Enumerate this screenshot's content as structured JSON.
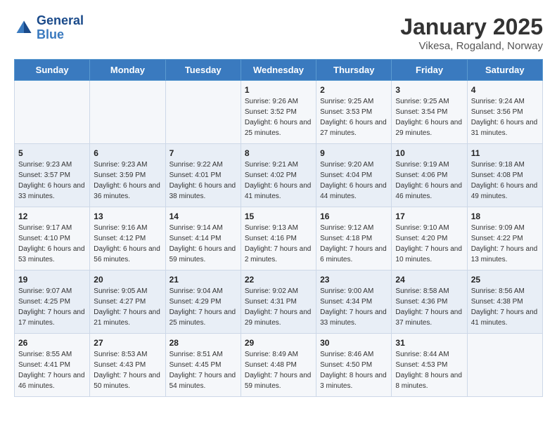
{
  "logo": {
    "line1": "General",
    "line2": "Blue"
  },
  "title": "January 2025",
  "subtitle": "Vikesa, Rogaland, Norway",
  "days_header": [
    "Sunday",
    "Monday",
    "Tuesday",
    "Wednesday",
    "Thursday",
    "Friday",
    "Saturday"
  ],
  "weeks": [
    [
      {
        "day": "",
        "content": ""
      },
      {
        "day": "",
        "content": ""
      },
      {
        "day": "",
        "content": ""
      },
      {
        "day": "1",
        "content": "Sunrise: 9:26 AM\nSunset: 3:52 PM\nDaylight: 6 hours and 25 minutes."
      },
      {
        "day": "2",
        "content": "Sunrise: 9:25 AM\nSunset: 3:53 PM\nDaylight: 6 hours and 27 minutes."
      },
      {
        "day": "3",
        "content": "Sunrise: 9:25 AM\nSunset: 3:54 PM\nDaylight: 6 hours and 29 minutes."
      },
      {
        "day": "4",
        "content": "Sunrise: 9:24 AM\nSunset: 3:56 PM\nDaylight: 6 hours and 31 minutes."
      }
    ],
    [
      {
        "day": "5",
        "content": "Sunrise: 9:23 AM\nSunset: 3:57 PM\nDaylight: 6 hours and 33 minutes."
      },
      {
        "day": "6",
        "content": "Sunrise: 9:23 AM\nSunset: 3:59 PM\nDaylight: 6 hours and 36 minutes."
      },
      {
        "day": "7",
        "content": "Sunrise: 9:22 AM\nSunset: 4:01 PM\nDaylight: 6 hours and 38 minutes."
      },
      {
        "day": "8",
        "content": "Sunrise: 9:21 AM\nSunset: 4:02 PM\nDaylight: 6 hours and 41 minutes."
      },
      {
        "day": "9",
        "content": "Sunrise: 9:20 AM\nSunset: 4:04 PM\nDaylight: 6 hours and 44 minutes."
      },
      {
        "day": "10",
        "content": "Sunrise: 9:19 AM\nSunset: 4:06 PM\nDaylight: 6 hours and 46 minutes."
      },
      {
        "day": "11",
        "content": "Sunrise: 9:18 AM\nSunset: 4:08 PM\nDaylight: 6 hours and 49 minutes."
      }
    ],
    [
      {
        "day": "12",
        "content": "Sunrise: 9:17 AM\nSunset: 4:10 PM\nDaylight: 6 hours and 53 minutes."
      },
      {
        "day": "13",
        "content": "Sunrise: 9:16 AM\nSunset: 4:12 PM\nDaylight: 6 hours and 56 minutes."
      },
      {
        "day": "14",
        "content": "Sunrise: 9:14 AM\nSunset: 4:14 PM\nDaylight: 6 hours and 59 minutes."
      },
      {
        "day": "15",
        "content": "Sunrise: 9:13 AM\nSunset: 4:16 PM\nDaylight: 7 hours and 2 minutes."
      },
      {
        "day": "16",
        "content": "Sunrise: 9:12 AM\nSunset: 4:18 PM\nDaylight: 7 hours and 6 minutes."
      },
      {
        "day": "17",
        "content": "Sunrise: 9:10 AM\nSunset: 4:20 PM\nDaylight: 7 hours and 10 minutes."
      },
      {
        "day": "18",
        "content": "Sunrise: 9:09 AM\nSunset: 4:22 PM\nDaylight: 7 hours and 13 minutes."
      }
    ],
    [
      {
        "day": "19",
        "content": "Sunrise: 9:07 AM\nSunset: 4:25 PM\nDaylight: 7 hours and 17 minutes."
      },
      {
        "day": "20",
        "content": "Sunrise: 9:05 AM\nSunset: 4:27 PM\nDaylight: 7 hours and 21 minutes."
      },
      {
        "day": "21",
        "content": "Sunrise: 9:04 AM\nSunset: 4:29 PM\nDaylight: 7 hours and 25 minutes."
      },
      {
        "day": "22",
        "content": "Sunrise: 9:02 AM\nSunset: 4:31 PM\nDaylight: 7 hours and 29 minutes."
      },
      {
        "day": "23",
        "content": "Sunrise: 9:00 AM\nSunset: 4:34 PM\nDaylight: 7 hours and 33 minutes."
      },
      {
        "day": "24",
        "content": "Sunrise: 8:58 AM\nSunset: 4:36 PM\nDaylight: 7 hours and 37 minutes."
      },
      {
        "day": "25",
        "content": "Sunrise: 8:56 AM\nSunset: 4:38 PM\nDaylight: 7 hours and 41 minutes."
      }
    ],
    [
      {
        "day": "26",
        "content": "Sunrise: 8:55 AM\nSunset: 4:41 PM\nDaylight: 7 hours and 46 minutes."
      },
      {
        "day": "27",
        "content": "Sunrise: 8:53 AM\nSunset: 4:43 PM\nDaylight: 7 hours and 50 minutes."
      },
      {
        "day": "28",
        "content": "Sunrise: 8:51 AM\nSunset: 4:45 PM\nDaylight: 7 hours and 54 minutes."
      },
      {
        "day": "29",
        "content": "Sunrise: 8:49 AM\nSunset: 4:48 PM\nDaylight: 7 hours and 59 minutes."
      },
      {
        "day": "30",
        "content": "Sunrise: 8:46 AM\nSunset: 4:50 PM\nDaylight: 8 hours and 3 minutes."
      },
      {
        "day": "31",
        "content": "Sunrise: 8:44 AM\nSunset: 4:53 PM\nDaylight: 8 hours and 8 minutes."
      },
      {
        "day": "",
        "content": ""
      }
    ]
  ]
}
